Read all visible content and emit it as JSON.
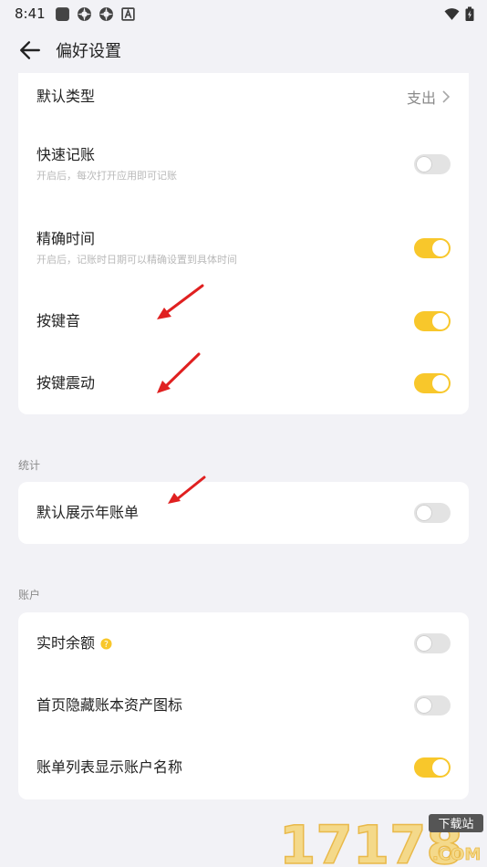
{
  "status_bar": {
    "time": "8:41"
  },
  "header": {
    "title": "偏好设置"
  },
  "card_main": {
    "default_type": {
      "label": "默认类型",
      "value": "支出"
    },
    "quick_record": {
      "label": "快速记账",
      "sub": "开启后，每次打开应用即可记账",
      "on": false
    },
    "precise_time": {
      "label": "精确时间",
      "sub": "开启后，记账时日期可以精确设置到具体时间",
      "on": true
    },
    "key_sound": {
      "label": "按键音",
      "on": true
    },
    "key_vibrate": {
      "label": "按键震动",
      "on": true
    }
  },
  "stats": {
    "section_label": "统计",
    "yearly_bill": {
      "label": "默认展示年账单",
      "on": false
    }
  },
  "accounts": {
    "section_label": "账户",
    "realtime_balance": {
      "label": "实时余额",
      "on": false
    },
    "hide_asset_icon": {
      "label": "首页隐藏账本资产图标",
      "on": false
    },
    "show_account_name": {
      "label": "账单列表显示账户名称",
      "on": true
    }
  },
  "colors": {
    "toggle_on": "#f8c72b",
    "toggle_off": "#e3e3e3",
    "arrow": "#e02020"
  },
  "watermark": {
    "text": "17178",
    "badge": "下载站",
    "domain": ".COM"
  }
}
